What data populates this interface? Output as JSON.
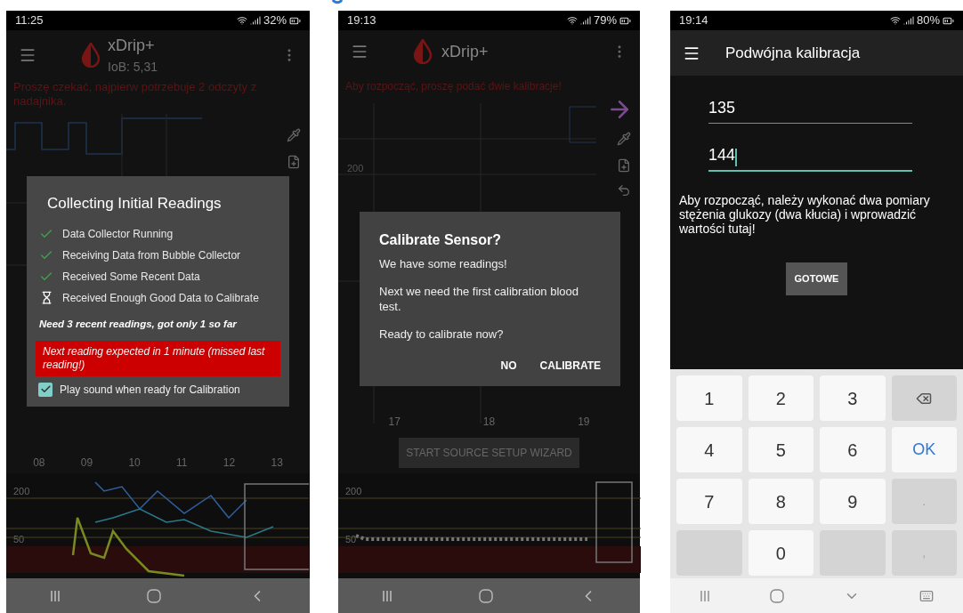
{
  "screen_1": {
    "status_bar": {
      "time": "11:25",
      "battery": "32%"
    },
    "app_bar": {
      "title": "xDrip+",
      "subtitle": "IoB: 5,31"
    },
    "notice": "Proszę czekać, najpierw potrzebuje 2 odczyty z nadajnika.",
    "hour_labels": [
      "08",
      "09",
      "10",
      "11",
      "12",
      "13"
    ],
    "mini_chart_labels": [
      "200",
      "50"
    ],
    "dialog": {
      "title": "Collecting Initial Readings",
      "steps": [
        {
          "label": "Data Collector Running",
          "done": true
        },
        {
          "label": "Receiving Data from Bubble Collector",
          "done": true
        },
        {
          "label": "Received Some Recent Data",
          "done": true
        },
        {
          "label": "Received Enough Good Data to Calibrate",
          "done": false
        }
      ],
      "note": "Need 3 recent readings, got only 1 so far",
      "warning": "Next reading expected in 1 minute (missed last reading!)",
      "checkbox": {
        "label": "Play sound when ready for Calibration",
        "checked": true
      }
    }
  },
  "screen_2": {
    "status_bar": {
      "time": "19:13",
      "battery": "79%"
    },
    "app_bar": {
      "title": "xDrip+"
    },
    "notice": "Aby rozpocząć, proszę podać dwie kalibracje!",
    "chart_label": "200",
    "hour_labels": [
      "17",
      "18",
      "19"
    ],
    "wizard_button": "START SOURCE SETUP WIZARD",
    "mini_chart_labels": [
      "200",
      "50"
    ],
    "dialog": {
      "title": "Calibrate Sensor?",
      "paragraphs": [
        "We have some readings!",
        "Next we need the first calibration blood test.",
        "Ready to calibrate now?"
      ],
      "buttons": [
        "NO",
        "CALIBRATE"
      ]
    }
  },
  "screen_3": {
    "status_bar": {
      "time": "19:14",
      "battery": "80%"
    },
    "title": "Podwójna kalibracja",
    "fields": [
      {
        "value": "135",
        "focused": false
      },
      {
        "value": "144",
        "focused": true
      }
    ],
    "instructions": "Aby rozpocząć, należy wykonać dwa pomiary stężenia glukozy (dwa kłucia) i wprowadzić wartości tutaj!",
    "button": "GOTOWE",
    "keys": [
      {
        "kind": "digit",
        "label": "1"
      },
      {
        "kind": "digit",
        "label": "2"
      },
      {
        "kind": "digit",
        "label": "3"
      },
      {
        "kind": "backspace"
      },
      {
        "kind": "digit",
        "label": "4"
      },
      {
        "kind": "digit",
        "label": "5"
      },
      {
        "kind": "digit",
        "label": "6"
      },
      {
        "kind": "ok",
        "label": "OK"
      },
      {
        "kind": "digit",
        "label": "7"
      },
      {
        "kind": "digit",
        "label": "8"
      },
      {
        "kind": "digit",
        "label": "9"
      },
      {
        "kind": "punct",
        "label": "."
      },
      {
        "kind": "blank"
      },
      {
        "kind": "digit",
        "label": "0"
      },
      {
        "kind": "blank"
      },
      {
        "kind": "punct",
        "label": ","
      }
    ]
  }
}
